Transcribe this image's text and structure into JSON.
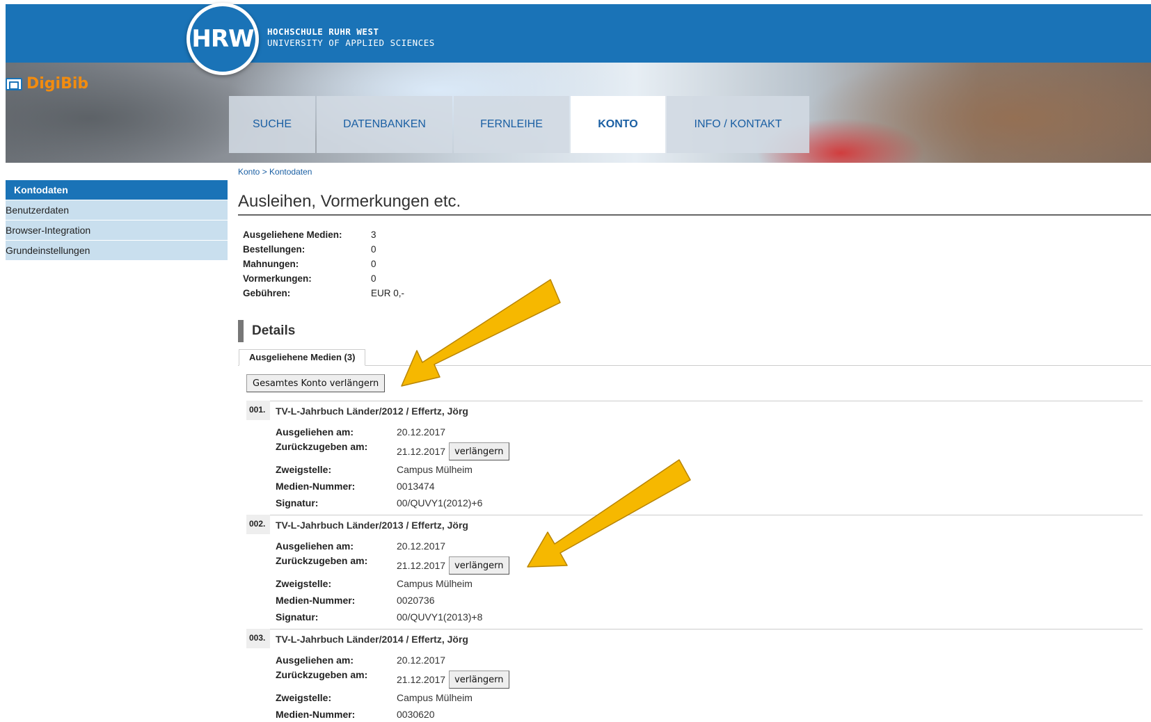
{
  "header": {
    "logo_text": "HRW",
    "university_line1": "HOCHSCHULE RUHR WEST",
    "university_line2": "UNIVERSITY OF APPLIED SCIENCES",
    "app_name": "DigiBib"
  },
  "nav": {
    "tabs": [
      {
        "label": "SUCHE"
      },
      {
        "label": "DATENBANKEN"
      },
      {
        "label": "FERNLEIHE"
      },
      {
        "label": "KONTO"
      },
      {
        "label": "INFO / KONTAKT"
      }
    ]
  },
  "sidebar": {
    "items": [
      {
        "label": "Kontodaten"
      },
      {
        "label": "Benutzerdaten"
      },
      {
        "label": "Browser-Integration"
      },
      {
        "label": "Grundeinstellungen"
      }
    ]
  },
  "breadcrumb": "Konto > Kontodaten",
  "page_title": "Ausleihen, Vormerkungen etc.",
  "summary": [
    {
      "label": "Ausgeliehene Medien:",
      "value": "3"
    },
    {
      "label": "Bestellungen:",
      "value": "0"
    },
    {
      "label": "Mahnungen:",
      "value": "0"
    },
    {
      "label": "Vormerkungen:",
      "value": "0"
    },
    {
      "label": "Gebühren:",
      "value": "EUR 0,-"
    }
  ],
  "details_heading": "Details",
  "tab_label": "Ausgeliehene Medien (3)",
  "renew_all_label": "Gesamtes Konto verlängern",
  "field_labels": {
    "borrowed": "Ausgeliehen am:",
    "due": "Zurückzugeben am:",
    "branch": "Zweigstelle:",
    "media_number": "Medien-Nummer:",
    "signature": "Signatur:"
  },
  "renew_label": "verlängern",
  "media": [
    {
      "num": "001.",
      "title": "TV-L-Jahrbuch Länder/2012 / Effertz, Jörg",
      "borrowed": "20.12.2017",
      "due": "21.12.2017",
      "branch": "Campus Mülheim",
      "media_number": "0013474",
      "signature": "00/QUVY1(2012)+6"
    },
    {
      "num": "002.",
      "title": "TV-L-Jahrbuch Länder/2013 / Effertz, Jörg",
      "borrowed": "20.12.2017",
      "due": "21.12.2017",
      "branch": "Campus Mülheim",
      "media_number": "0020736",
      "signature": "00/QUVY1(2013)+8"
    },
    {
      "num": "003.",
      "title": "TV-L-Jahrbuch Länder/2014 / Effertz, Jörg",
      "borrowed": "20.12.2017",
      "due": "21.12.2017",
      "branch": "Campus Mülheim",
      "media_number": "0030620",
      "signature": ""
    }
  ],
  "colors": {
    "brand_blue": "#1a73b7",
    "brand_orange": "#f28c0f",
    "sidebar_bg": "#c9dfee",
    "arrow_fill": "#f6b800"
  }
}
